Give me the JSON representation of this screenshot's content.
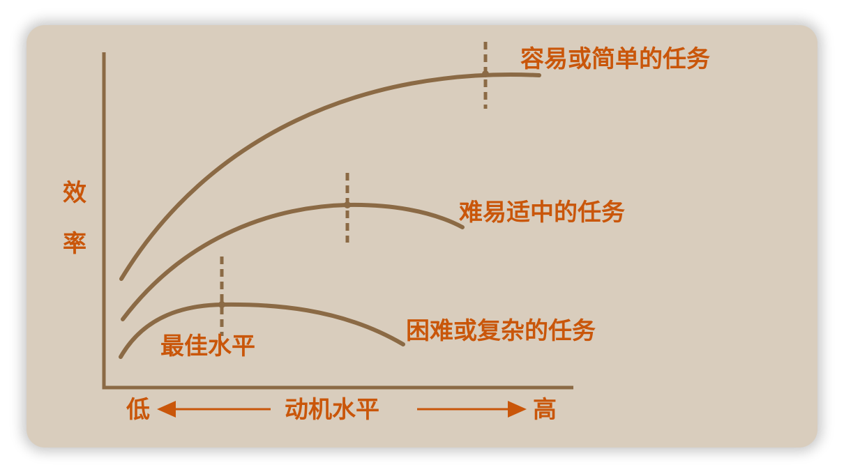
{
  "y_axis_label": [
    "效",
    "率"
  ],
  "x_axis": {
    "low": "低",
    "title": "动机水平",
    "high": "高"
  },
  "curves": [
    {
      "label": "容易或简单的任务"
    },
    {
      "label": "难易适中的任务"
    },
    {
      "label": "困难或复杂的任务"
    }
  ],
  "optimum_label": "最佳水平",
  "colors": {
    "background": "#d9cdbd",
    "curve": "#8b6a45",
    "text": "#c9560a"
  }
}
